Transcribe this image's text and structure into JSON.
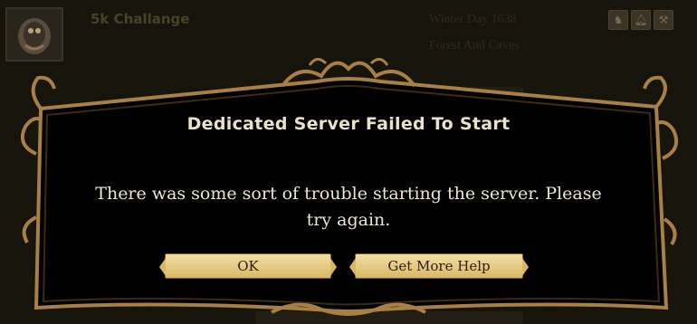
{
  "background": {
    "world_name": "5k Challange",
    "day": "Winter Day 1638",
    "location": "Forest And Caves",
    "icons": [
      "beefalo-icon",
      "bell-icon",
      "wrench-icon"
    ]
  },
  "dialog": {
    "title": "Dedicated Server Failed To Start",
    "message": "There was some sort of trouble starting the server. Please try again.",
    "buttons": {
      "ok": "OK",
      "help": "Get More Help"
    }
  },
  "colors": {
    "panel": "#000000",
    "frame": "#a87f45",
    "button": "#e6cd86",
    "text": "#ece6d4"
  }
}
